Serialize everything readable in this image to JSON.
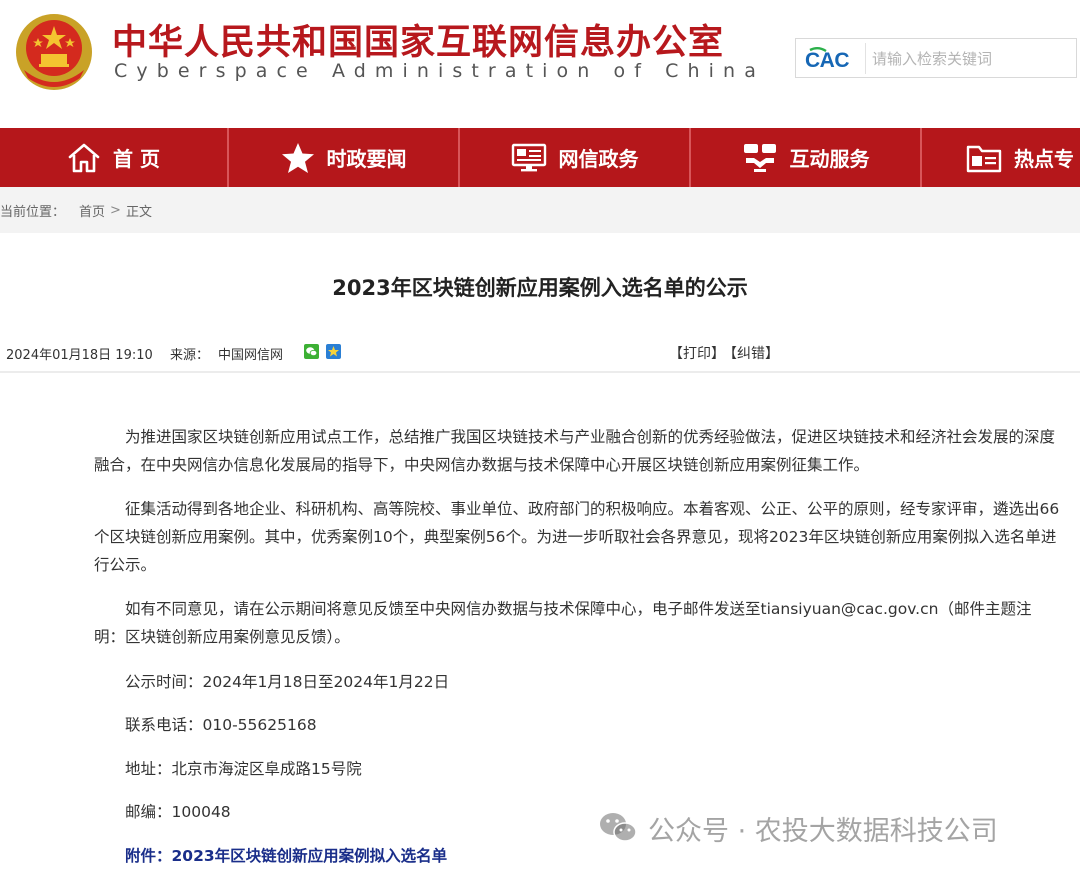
{
  "header": {
    "site_name_cn": "中华人民共和国国家互联网信息办公室",
    "site_name_en": "Cyberspace Administration of China",
    "search": {
      "logo_text": "CAC",
      "placeholder": "请输入检索关键词"
    }
  },
  "nav": {
    "items": [
      {
        "label": "首 页",
        "icon": "home-icon"
      },
      {
        "label": "时政要闻",
        "icon": "star-icon"
      },
      {
        "label": "网信政务",
        "icon": "screen-icon"
      },
      {
        "label": "互动服务",
        "icon": "handshake-icon"
      },
      {
        "label": "热点专",
        "icon": "folder-icon"
      }
    ],
    "color": "#b5171b"
  },
  "breadcrumb": {
    "prefix": "当前位置：",
    "items": [
      "首页",
      "正文"
    ],
    "separator": ">"
  },
  "article": {
    "title": "2023年区块链创新应用案例入选名单的公示",
    "date": "2024年01月18日 19:10",
    "source_label": "来源：",
    "source": "中国网信网",
    "print_label": "【打印】",
    "correct_label": "【纠错】",
    "paragraphs": [
      "为推进国家区块链创新应用试点工作，总结推广我国区块链技术与产业融合创新的优秀经验做法，促进区块链技术和经济社会发展的深度融合，在中央网信办信息化发展局的指导下，中央网信办数据与技术保障中心开展区块链创新应用案例征集工作。",
      "征集活动得到各地企业、科研机构、高等院校、事业单位、政府部门的积极响应。本着客观、公正、公平的原则，经专家评审，遴选出66个区块链创新应用案例。其中，优秀案例10个，典型案例56个。为进一步听取社会各界意见，现将2023年区块链创新应用案例拟入选名单进行公示。",
      "如有不同意见，请在公示期间将意见反馈至中央网信办数据与技术保障中心，电子邮件发送至tiansiyuan@cac.gov.cn（邮件主题注明：区块链创新应用案例意见反馈）。"
    ],
    "publicity_time": "公示时间：2024年1月18日至2024年1月22日",
    "phone": "联系电话：010-55625168",
    "address": "地址：北京市海淀区阜成路15号院",
    "postcode": "邮编：100048",
    "attachment": "附件：2023年区块链创新应用案例拟入选名单"
  },
  "watermark": {
    "text": "公众号 · 农投大数据科技公司",
    "icon": "wechat-icon"
  }
}
